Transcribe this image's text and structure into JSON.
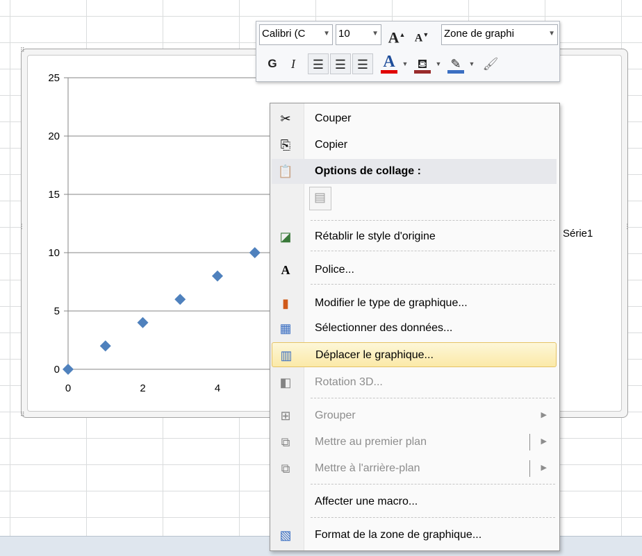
{
  "mini_toolbar": {
    "font_name": "Calibri (C",
    "font_size": "10",
    "grow_font": "A",
    "shrink_font": "A",
    "element_selector": "Zone de graphi",
    "bold": "G",
    "italic": "I",
    "font_color_glyph": "A"
  },
  "context_menu": {
    "items": [
      {
        "label": "Couper",
        "icon": "scissors-icon",
        "enabled": true
      },
      {
        "label": "Copier",
        "icon": "copy-icon",
        "enabled": true
      },
      {
        "label": "Options de collage :",
        "icon": "paste-icon",
        "enabled": true
      },
      {
        "label": "Rétablir le style d'origine",
        "icon": "reset-style-icon",
        "enabled": true
      },
      {
        "label": "Police...",
        "icon": "font-icon",
        "enabled": true
      },
      {
        "label": "Modifier le type de graphique...",
        "icon": "chart-type-icon",
        "enabled": true
      },
      {
        "label": "Sélectionner des données...",
        "icon": "select-data-icon",
        "enabled": true
      },
      {
        "label": "Déplacer le graphique...",
        "icon": "move-chart-icon",
        "enabled": true,
        "highlighted": true
      },
      {
        "label": "Rotation 3D...",
        "icon": "rotation-3d-icon",
        "enabled": false
      },
      {
        "label": "Grouper",
        "icon": "group-icon",
        "enabled": false
      },
      {
        "label": "Mettre au premier plan",
        "icon": "bring-forward-icon",
        "enabled": false
      },
      {
        "label": "Mettre à l'arrière-plan",
        "icon": "send-backward-icon",
        "enabled": false
      },
      {
        "label": "Affecter une macro...",
        "icon": "",
        "enabled": true
      },
      {
        "label": "Format de la zone de graphique...",
        "icon": "format-chart-area-icon",
        "enabled": true
      }
    ]
  },
  "chart_data": {
    "type": "scatter",
    "series": [
      {
        "name": "Série1",
        "x": [
          0,
          1,
          2,
          3,
          4,
          5
        ],
        "y": [
          0,
          2,
          4,
          6,
          8,
          10
        ]
      }
    ],
    "x_ticks": [
      "0",
      "2",
      "4"
    ],
    "y_ticks": [
      "0",
      "5",
      "10",
      "15",
      "20",
      "25"
    ],
    "ylim": [
      0,
      25
    ],
    "marker": "diamond",
    "grid": "horizontal",
    "color": "#4f81bd",
    "legend": "right"
  }
}
